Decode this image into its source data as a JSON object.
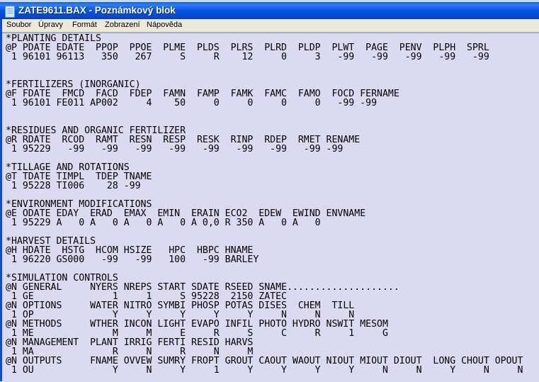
{
  "window": {
    "title": "ZATE9611.BAX - Poznámkový blok",
    "icon": "notepad-icon"
  },
  "menu": [
    "Soubor",
    "Úpravy",
    "Formát",
    "Zobrazení",
    "Nápověda"
  ],
  "lines": [
    "*PLANTING DETAILS",
    "@P PDATE EDATE  PPOP  PPOE  PLME  PLDS  PLRS  PLRD  PLDP  PLWT  PAGE  PENV  PLPH  SPRL",
    " 1 96101 96113   350   267     S     R    12     0     3   -99   -99   -99   -99   -99",
    "",
    "",
    "*FERTILIZERS (INORGANIC)",
    "@F FDATE  FMCD  FACD  FDEP  FAMN  FAMP  FAMK  FAMC  FAMO  FOCD FERNAME",
    " 1 96101 FE011 AP002     4    50     0     0     0     0   -99 -99",
    "",
    "",
    "*RESIDUES AND ORGANIC FERTILIZER",
    "@R RDATE  RCOD  RAMT  RESN  RESP  RESK  RINP  RDEP  RMET RENAME",
    " 1 95229   -99   -99   -99   -99   -99   -99   -99   -99 -99",
    "",
    "*TILLAGE AND ROTATIONS",
    "@T TDATE TIMPL  TDEP TNAME",
    " 1 95228 TI006    28 -99",
    "",
    "*ENVIRONMENT MODIFICATIONS",
    "@E ODATE EDAY  ERAD  EMAX  EMIN  ERAIN ECO2  EDEW  EWIND ENVNAME",
    " 1 95229 A   0 A   0 A   0 A   0 A 0,0 R 350 A   0 A   0",
    "",
    "*HARVEST DETAILS",
    "@H HDATE  HSTG  HCOM HSIZE   HPC  HBPC HNAME",
    " 1 96220 GS000   -99   -99   100   -99 BARLEY",
    "",
    "*SIMULATION CONTROLS",
    "@N GENERAL     NYERS NREPS START SDATE RSEED SNAME....................",
    " 1 GE              1     1     S 95228  2150 ZATEC",
    "@N OPTIONS     WATER NITRO SYMBI PHOSP POTAS DISES  CHEM  TILL",
    " 1 OP              Y     Y     Y     Y     Y     N     N     N",
    "@N METHODS     WTHER INCON LIGHT EVAPO INFIL PHOTO HYDRO NSWIT MESOM",
    " 1 ME              M     M     E     R     S     C     R     1     G",
    "@N MANAGEMENT  PLANT IRRIG FERTI RESID HARVS",
    " 1 MA              R     N     R     N     M",
    "@N OUTPUTS     FNAME OVVEW SUMRY FROPT GROUT CAOUT WAOUT NIOUT MIOUT DIOUT  LONG CHOUT OPOUT",
    " 1 OU              Y     N     Y     1     Y     Y     Y     Y     N     N     Y     N     N"
  ]
}
